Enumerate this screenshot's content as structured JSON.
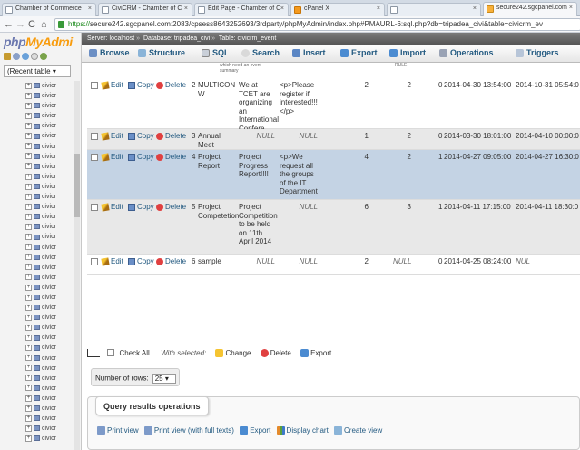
{
  "browser": {
    "tabs": [
      {
        "title": "Chamber of Commerce"
      },
      {
        "title": "CiviCRM - Chamber of C"
      },
      {
        "title": "Edit Page - Chamber of C"
      },
      {
        "title": "cPanel X"
      },
      {
        "title": ""
      },
      {
        "title": "secure242.sgcpanel.com"
      }
    ],
    "url_scheme": "https://",
    "url_rest": "secure242.sgcpanel.com:2083/cpsess8643252693/3rdparty/phpMyAdmin/index.php#PMAURL-6:sql.php?db=tripadea_civi&table=civicrm_ev"
  },
  "sidebar": {
    "logo_php": "php",
    "logo_my": "MyAdmi",
    "recent_label": "(Recent table",
    "tree_items": [
      "civicr",
      "civicr",
      "civicr",
      "civicr",
      "civicr",
      "civicr",
      "civicr",
      "civicr",
      "civicr",
      "civicr",
      "civicr",
      "civicr",
      "civicr",
      "civicr",
      "civicr",
      "civicr",
      "civicr",
      "civicr",
      "civicr",
      "civicr",
      "civicr",
      "civicr",
      "civicr",
      "civicr",
      "civicr",
      "civicr",
      "civicr",
      "civicr",
      "civicr",
      "civicr",
      "civicr",
      "civicr",
      "civicr",
      "civicr",
      "civicr",
      "civicr"
    ]
  },
  "breadcrumb": {
    "server": "Server: localhost",
    "database": "Database: tripadea_civi",
    "table": "Table: civicrm_event"
  },
  "tabs": {
    "browse": "Browse",
    "structure": "Structure",
    "sql": "SQL",
    "search": "Search",
    "insert": "Insert",
    "export": "Export",
    "import": "Import",
    "operations": "Operations",
    "triggers": "Triggers"
  },
  "actions": {
    "edit": "Edit",
    "copy": "Copy",
    "delete": "Delete"
  },
  "partial_header": {
    "summary": "which need an event summary",
    "rules": "RULE"
  },
  "rows": [
    {
      "id": "2",
      "title": "MULTICON W",
      "summary": "We at TCET are organizing an International Confere...",
      "description": "<p>Please register if interested!!!</p>",
      "c5": "2",
      "c6": "2",
      "c7": "0",
      "start": "2014-04-30 13:54:00",
      "end": "2014-10-31 05:54:0"
    },
    {
      "id": "3",
      "title": "Annual Meet",
      "summary": "NULL",
      "description": "NULL",
      "c5": "1",
      "c6": "2",
      "c7": "0",
      "start": "2014-03-30 18:01:00",
      "end": "2014-04-10 00:00:0"
    },
    {
      "id": "4",
      "title": "Project Report",
      "summary": "Project Progress Report!!!!",
      "description": "<p>We request all the groups of the IT Department",
      "c5": "4",
      "c6": "2",
      "c7": "1",
      "start": "2014-04-27 09:05:00",
      "end": "2014-04-27 16:30:0"
    },
    {
      "id": "5",
      "title": "Project Competetion",
      "summary": "Project Competition to be held on 11th April 2014",
      "description": "NULL",
      "c5": "6",
      "c6": "3",
      "c7": "1",
      "start": "2014-04-11 17:15:00",
      "end": "2014-04-11 18:30:0"
    },
    {
      "id": "6",
      "title": "sample",
      "summary": "NULL",
      "description": "NULL",
      "c5": "2",
      "c6": "NULL",
      "c7": "0",
      "start": "2014-04-25 08:24:00",
      "end": "NUL"
    }
  ],
  "bulk": {
    "check_all": "Check All",
    "with_selected": "With selected:",
    "change": "Change",
    "delete": "Delete",
    "export": "Export"
  },
  "number_of_rows": {
    "label": "Number of rows:",
    "value": "25"
  },
  "query_results": {
    "title": "Query results operations",
    "print_view": "Print view",
    "print_full": "Print view (with full texts)",
    "export": "Export",
    "display_chart": "Display chart",
    "create_view": "Create view"
  }
}
